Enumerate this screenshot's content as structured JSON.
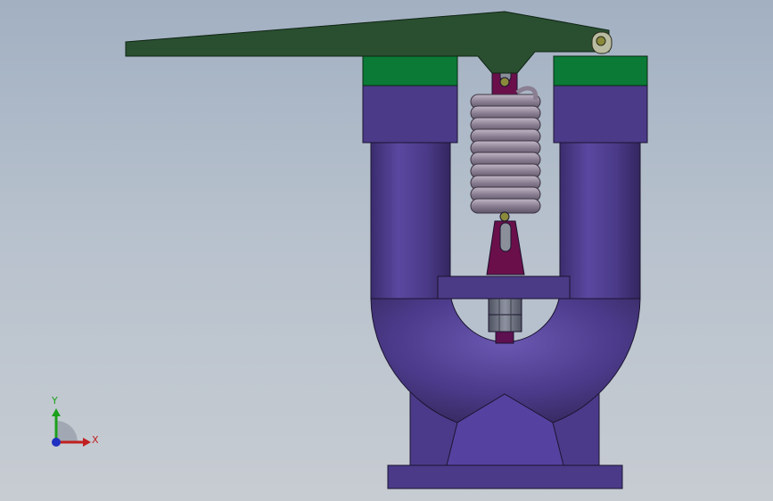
{
  "view": {
    "background_top": "#a2b0c2",
    "background_bottom": "#c7ccd2"
  },
  "model": {
    "parts": [
      {
        "name": "lever-arm",
        "color": "#2a4f30"
      },
      {
        "name": "left-cap",
        "color": "#0a7a36"
      },
      {
        "name": "right-cap",
        "color": "#0a7a36"
      },
      {
        "name": "u-body",
        "color": "#4d3c8a"
      },
      {
        "name": "tension-spring",
        "color": "#8a7f92"
      },
      {
        "name": "clevis",
        "color": "#6a0f4a"
      },
      {
        "name": "cross-plate",
        "color": "#4b3a86"
      },
      {
        "name": "hex-nuts",
        "color": "#6f7482"
      },
      {
        "name": "base-flange",
        "color": "#4a3a88"
      }
    ]
  },
  "triad": {
    "x_label": "X",
    "y_label": "Y",
    "x_color": "#c02020",
    "y_color": "#1ca01c",
    "z_color": "#2030c0"
  }
}
